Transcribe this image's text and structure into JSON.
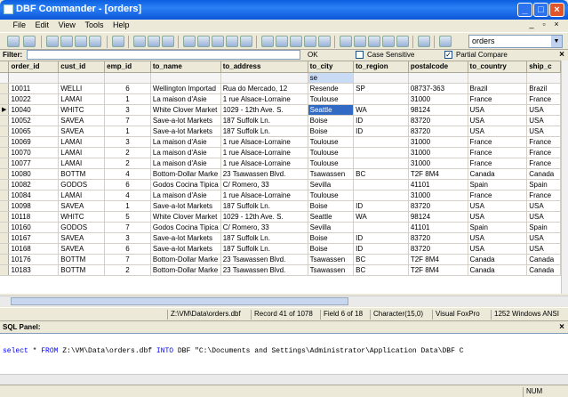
{
  "app": {
    "title": "DBF Commander - [orders]"
  },
  "menu": [
    "File",
    "Edit",
    "View",
    "Tools",
    "Help"
  ],
  "toolbar": {
    "table_select": "orders"
  },
  "filter": {
    "label": "Filter:",
    "ok": "OK",
    "case_sensitive": "Case Sensitive",
    "partial_compare": "Partial Compare",
    "case_checked": false,
    "partial_checked": true
  },
  "columns": [
    "order_id",
    "cust_id",
    "emp_id",
    "to_name",
    "to_address",
    "to_city",
    "to_region",
    "postalcode",
    "to_country",
    "ship_c"
  ],
  "filter_row": [
    "",
    "",
    "",
    "",
    "",
    "se",
    "",
    "",
    "",
    ""
  ],
  "rows": [
    [
      "10011",
      "WELLI",
      "6",
      "Wellington Importad",
      "Rua do Mercado, 12",
      "Resende",
      "SP",
      "08737-363",
      "Brazil",
      "Brazil"
    ],
    [
      "10022",
      "LAMAI",
      "1",
      "La maison d'Asie",
      "1 rue Alsace-Lorraine",
      "Toulouse",
      "",
      "31000",
      "France",
      "France"
    ],
    [
      "10040",
      "WHITC",
      "3",
      "White Clover Market",
      "1029 - 12th Ave. S.",
      "Seattle",
      "WA",
      "98124",
      "USA",
      "USA"
    ],
    [
      "10052",
      "SAVEA",
      "7",
      "Save-a-lot Markets",
      "187 Suffolk Ln.",
      "Boise",
      "ID",
      "83720",
      "USA",
      "USA"
    ],
    [
      "10065",
      "SAVEA",
      "1",
      "Save-a-lot Markets",
      "187 Suffolk Ln.",
      "Boise",
      "ID",
      "83720",
      "USA",
      "USA"
    ],
    [
      "10069",
      "LAMAI",
      "3",
      "La maison d'Asie",
      "1 rue Alsace-Lorraine",
      "Toulouse",
      "",
      "31000",
      "France",
      "France"
    ],
    [
      "10070",
      "LAMAI",
      "2",
      "La maison d'Asie",
      "1 rue Alsace-Lorraine",
      "Toulouse",
      "",
      "31000",
      "France",
      "France"
    ],
    [
      "10077",
      "LAMAI",
      "2",
      "La maison d'Asie",
      "1 rue Alsace-Lorraine",
      "Toulouse",
      "",
      "31000",
      "France",
      "France"
    ],
    [
      "10080",
      "BOTTM",
      "4",
      "Bottom-Dollar Marke",
      "23 Tsawassen Blvd.",
      "Tsawassen",
      "BC",
      "T2F 8M4",
      "Canada",
      "Canada"
    ],
    [
      "10082",
      "GODOS",
      "6",
      "Godos Cocina Tipica",
      "C/ Romero, 33",
      "Sevilla",
      "",
      "41101",
      "Spain",
      "Spain"
    ],
    [
      "10084",
      "LAMAI",
      "4",
      "La maison d'Asie",
      "1 rue Alsace-Lorraine",
      "Toulouse",
      "",
      "31000",
      "France",
      "France"
    ],
    [
      "10098",
      "SAVEA",
      "1",
      "Save-a-lot Markets",
      "187 Suffolk Ln.",
      "Boise",
      "ID",
      "83720",
      "USA",
      "USA"
    ],
    [
      "10118",
      "WHITC",
      "5",
      "White Clover Market",
      "1029 - 12th Ave. S.",
      "Seattle",
      "WA",
      "98124",
      "USA",
      "USA"
    ],
    [
      "10160",
      "GODOS",
      "7",
      "Godos Cocina Tipica",
      "C/ Romero, 33",
      "Sevilla",
      "",
      "41101",
      "Spain",
      "Spain"
    ],
    [
      "10167",
      "SAVEA",
      "3",
      "Save-a-lot Markets",
      "187 Suffolk Ln.",
      "Boise",
      "ID",
      "83720",
      "USA",
      "USA"
    ],
    [
      "10168",
      "SAVEA",
      "6",
      "Save-a-lot Markets",
      "187 Suffolk Ln.",
      "Boise",
      "ID",
      "83720",
      "USA",
      "USA"
    ],
    [
      "10176",
      "BOTTM",
      "7",
      "Bottom-Dollar Marke",
      "23 Tsawassen Blvd.",
      "Tsawassen",
      "BC",
      "T2F 8M4",
      "Canada",
      "Canada"
    ],
    [
      "10183",
      "BOTTM",
      "2",
      "Bottom-Dollar Marke",
      "23 Tsawassen Blvd.",
      "Tsawassen",
      "BC",
      "T2F 8M4",
      "Canada",
      "Canada"
    ]
  ],
  "status": {
    "path": "Z:\\VM\\Data\\orders.dbf",
    "record": "Record 41 of 1078",
    "field": "Field 6 of 18",
    "type": "Character(15,0)",
    "format": "Visual FoxPro",
    "codepage": "1252 Windows ANSI"
  },
  "sql": {
    "label": "SQL Panel:",
    "kw1": "select",
    "p1": " * ",
    "kw2": "FROM",
    "p2": " Z:\\VM\\Data\\orders.dbf ",
    "kw3": "INTO",
    "p3": " DBF \"C:\\Documents and Settings\\Administrator\\Application Data\\DBF C"
  },
  "bottom": {
    "num": "NUM"
  }
}
